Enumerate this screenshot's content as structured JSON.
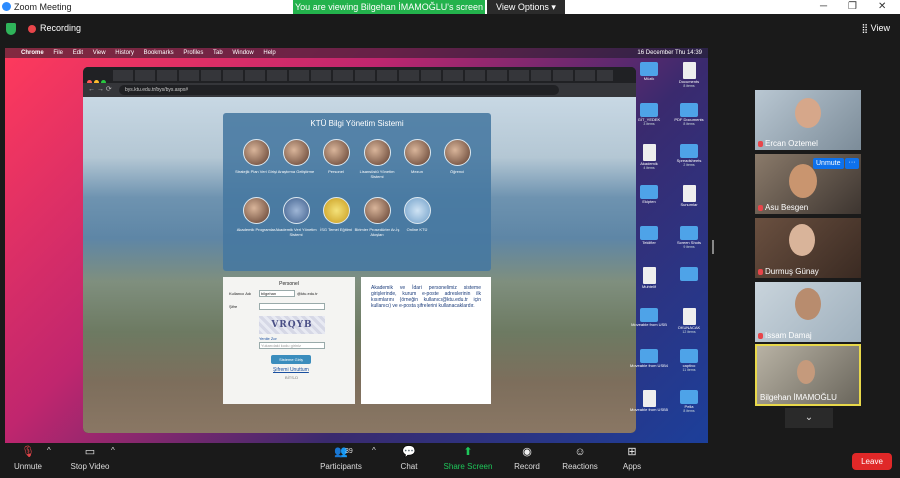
{
  "window": {
    "title": "Zoom Meeting"
  },
  "banner": {
    "viewing": "You are viewing Bilgehan İMAMOĞLU's screen",
    "options": "View Options"
  },
  "top": {
    "recording": "Recording",
    "view": "View"
  },
  "mac_menu": {
    "items": [
      "Chrome",
      "File",
      "Edit",
      "View",
      "History",
      "Bookmarks",
      "Profiles",
      "Tab",
      "Window",
      "Help"
    ],
    "clock": "16 December Thu 14:39"
  },
  "browser": {
    "url": "bys.ktu.edu.tr/bys/bys.aspx#"
  },
  "portal": {
    "title": "KTÜ Bilgi Yönetim Sistemi",
    "icons": [
      "Stratejik Plan Veri Girişi",
      "Araştırma Geliştirme",
      "Personel",
      "Lisansüstü Yönetim Sistemi",
      "Mezun",
      "Öğrenci",
      "Akademik Programlar",
      "Akademik Veri Yönetim Sistemi",
      "İSG Temel Eğitimi",
      "Birimler Prosedürler Ar-İş Akışları",
      "Online KTÜ"
    ]
  },
  "login": {
    "title": "Personel",
    "user_label": "Kullanıcı Adı",
    "user_value": "bilgehan",
    "domain": "@ktu.edu.tr",
    "password_label": "Şifre",
    "captcha_text": "VRQYB",
    "refresh": "Yenile Zor",
    "code_placeholder": "Yukarıdaki kodu giriniz",
    "submit": "Sisteme Giriş",
    "forgot": "Şifremi Unuttum",
    "footer": "BİTS-D"
  },
  "info": {
    "text": "Akademik ve İdari personelimiz sisteme girişlerinde, kurum e-poste adreslerinin ilk kısımlarını (örneğin kullanıcı@ktu.edu.tr için kullanıcı) ve e-posta şifrelerini kullanacaklardır."
  },
  "finder": [
    {
      "name": "Müzik",
      "sub": ""
    },
    {
      "name": "Documents",
      "sub": "8 items"
    },
    {
      "name": "GİT_YEDEK",
      "sub": "3 items"
    },
    {
      "name": "PDF Documents",
      "sub": "8 items"
    },
    {
      "name": "Akademik",
      "sub": "4 items"
    },
    {
      "name": "Spreadsheets",
      "sub": "2 items"
    },
    {
      "name": "Ekipten",
      "sub": ""
    },
    {
      "name": "Sunumlar",
      "sub": ""
    },
    {
      "name": "Teklifler",
      "sub": ""
    },
    {
      "name": "Screen Shots",
      "sub": "9 items"
    },
    {
      "name": "Muhtelif",
      "sub": ""
    },
    {
      "name": "",
      "sub": ""
    },
    {
      "name": "Moveable from USB",
      "sub": ""
    },
    {
      "name": "OKUNACAK",
      "sub": "12 items"
    },
    {
      "name": "Moveable from USB4",
      "sub": ""
    },
    {
      "name": "captivo",
      "sub": "11 items"
    },
    {
      "name": "Moveable from USB5",
      "sub": ""
    },
    {
      "name": "Pella",
      "sub": "8 items"
    }
  ],
  "participants": [
    {
      "name": "Ercan Oztemel",
      "muted": true
    },
    {
      "name": "Asu Besgen",
      "muted": true,
      "overlay": "Unmute"
    },
    {
      "name": "Durmuş Günay",
      "muted": true
    },
    {
      "name": "Issam Damaj",
      "muted": true
    },
    {
      "name": "Bilgehan İMAMOĞLU",
      "muted": false,
      "active": true
    }
  ],
  "toolbar": {
    "unmute": "Unmute",
    "stop_video": "Stop Video",
    "participants": "Participants",
    "participants_count": "39",
    "chat": "Chat",
    "share": "Share Screen",
    "record": "Record",
    "reactions": "Reactions",
    "apps": "Apps",
    "leave": "Leave"
  },
  "colors": {
    "share_green": "#23b24c",
    "zoom_blue": "#0e71eb",
    "leave_red": "#e02828",
    "active_border": "#e8d84a"
  }
}
